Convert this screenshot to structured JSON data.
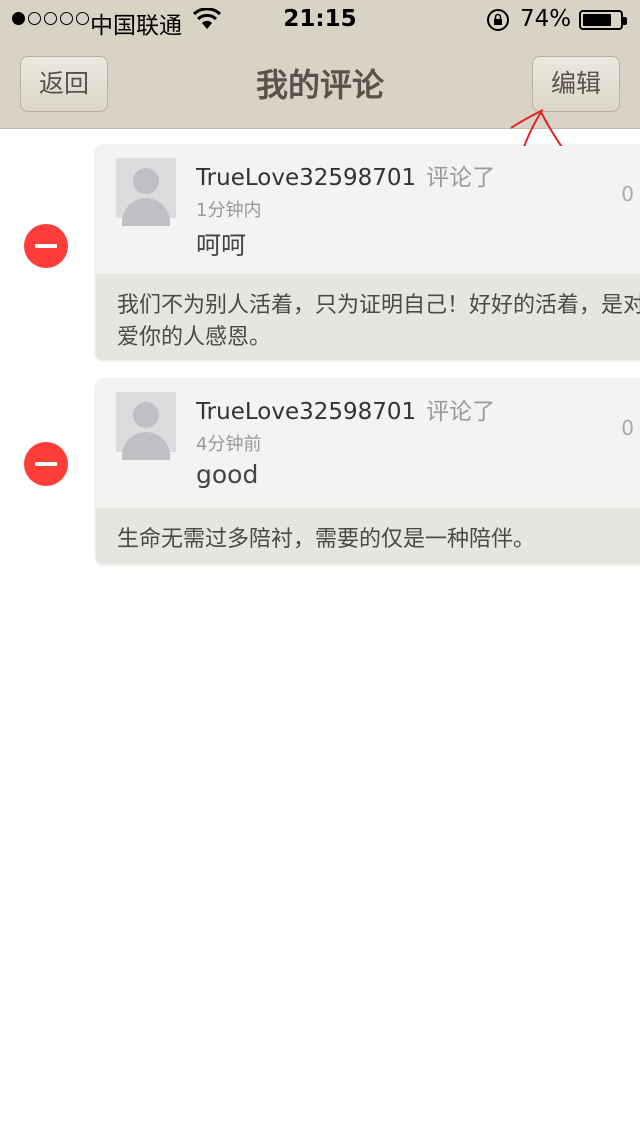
{
  "status_bar": {
    "carrier": "中国联通",
    "time": "21:15",
    "battery_percent": "74%"
  },
  "nav": {
    "back_label": "返回",
    "title": "我的评论",
    "edit_label": "编辑"
  },
  "comments": [
    {
      "username": "TrueLove32598701",
      "action": "评论了",
      "time": "1分钟内",
      "text": "呵呵",
      "count": "0",
      "quote": "我们不为别人活着，只为证明自己！好好的活着，是对爱你的人感恩。"
    },
    {
      "username": "TrueLove32598701",
      "action": "评论了",
      "time": "4分钟前",
      "text": "good",
      "count": "0",
      "quote": "生命无需过多陪衬，需要的仅是一种陪伴。"
    }
  ],
  "colors": {
    "nav_background": "#d9d3c6",
    "delete_red": "#fc3d39",
    "annotation_red": "#e0242a"
  }
}
